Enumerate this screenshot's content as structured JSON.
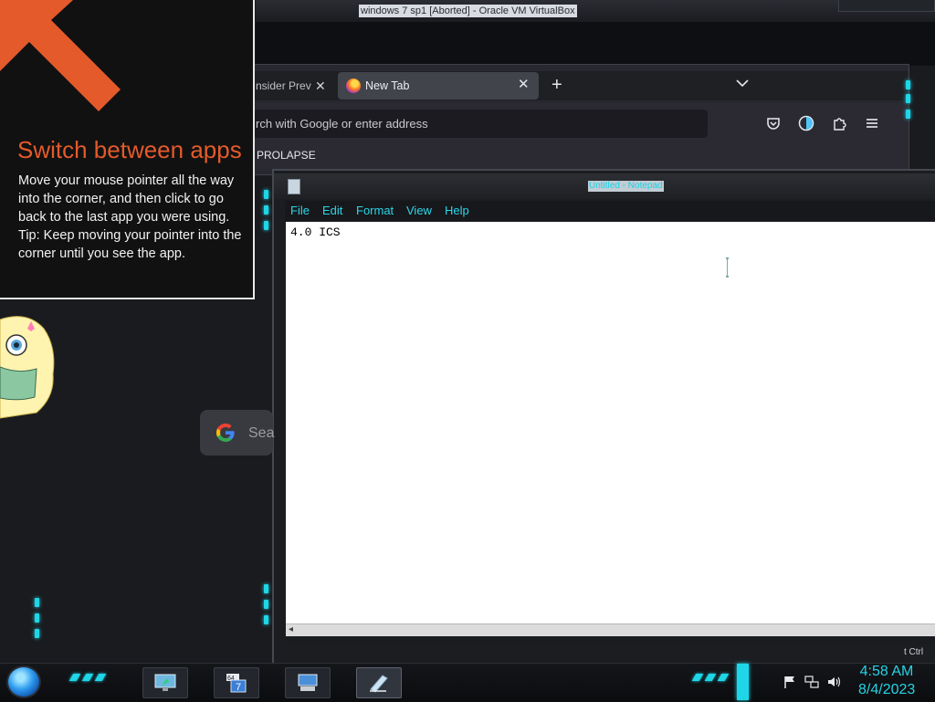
{
  "vm": {
    "title": "windows 7 sp1 [Aborted] - Oracle VM VirtualBox",
    "right_ctrl": "t Ctrl"
  },
  "firefox": {
    "tabs": [
      {
        "label": "nsider Prev",
        "close": "✕"
      },
      {
        "label": "New Tab",
        "close": "✕"
      }
    ],
    "new_tab_glyph": "+",
    "url_placeholder": "rch with Google or enter address",
    "bookmark": "PROLAPSE",
    "toolbar_icons": [
      "pocket-icon",
      "firefox-view-icon",
      "extensions-icon",
      "menu-icon"
    ]
  },
  "notepad": {
    "title": "Untitled - Notepad",
    "menu": [
      "File",
      "Edit",
      "Format",
      "View",
      "Help"
    ],
    "content": "4.0 ICS"
  },
  "google_box": {
    "text": "Sea"
  },
  "hint": {
    "title": "Switch between apps",
    "body_lines": [
      "Move your mouse pointer all the way into the corner, and then click to go back to the last app you were using.",
      "Tip: Keep moving your pointer into the corner until you see the app."
    ]
  },
  "taskbar": {
    "apps": [
      "app-1",
      "app-2",
      "app-3",
      "notepad"
    ],
    "badge": "64",
    "badge_number": "7",
    "clock": {
      "time": "4:58 AM",
      "date": "8/4/2023"
    }
  },
  "colors": {
    "accent_cyan": "#1fd6e8",
    "hint_orange": "#e45a2b"
  }
}
